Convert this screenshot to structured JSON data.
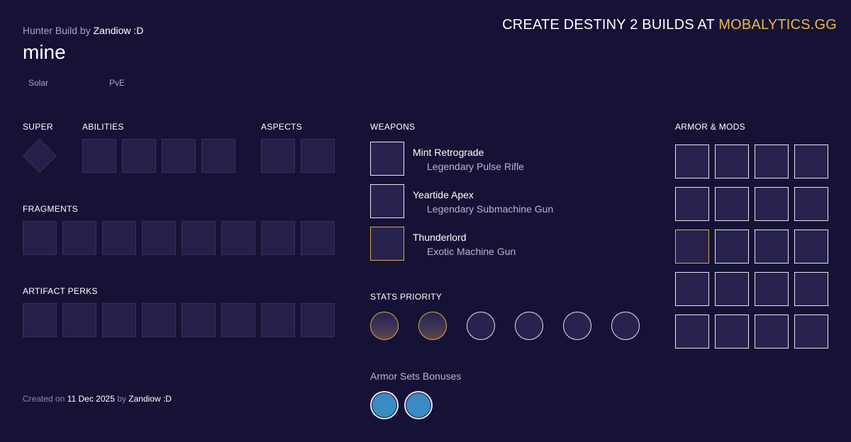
{
  "header": {
    "class_build_prefix": "Hunter Build by",
    "author": "Zandiow :D",
    "build_name": "mine",
    "tags": [
      "Solar",
      "PvE"
    ],
    "promo_text": "CREATE DESTINY 2 BUILDS AT",
    "promo_brand": "MOBALYTICS.GG"
  },
  "sections": {
    "super": "SUPER",
    "abilities": "ABILITIES",
    "aspects": "ASPECTS",
    "fragments": "FRAGMENTS",
    "artifact_perks": "ARTIFACT PERKS",
    "weapons": "WEAPONS",
    "armor_mods": "ARMOR & MODS",
    "stats_priority": "STATS PRIORITY",
    "armor_sets": "Armor Sets Bonuses"
  },
  "weapons": [
    {
      "name": "Mint Retrograde",
      "type": "Legendary Pulse Rifle",
      "rarity": "legendary"
    },
    {
      "name": "Yeartide Apex",
      "type": "Legendary Submachine Gun",
      "rarity": "legendary"
    },
    {
      "name": "Thunderlord",
      "type": "Exotic Machine Gun",
      "rarity": "exotic"
    }
  ],
  "footer": {
    "created_on_label": "Created on",
    "date": "11 Dec 2025",
    "by_label": "by",
    "author": "Zandiow :D"
  },
  "colors": {
    "background": "#161235",
    "exotic_accent": "#e9b94a",
    "set_bonus": "#3a8ac4"
  }
}
